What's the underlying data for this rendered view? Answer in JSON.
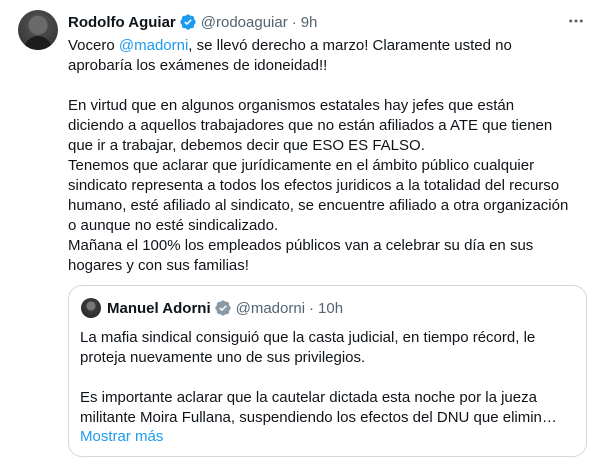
{
  "tweet": {
    "author_name": "Rodolfo Aguiar",
    "handle": "@rodoaguiar",
    "separator": "·",
    "time": "9h",
    "lines": [
      "Vocero ",
      "@madorni",
      ", se llevó derecho a marzo! Claramente usted no",
      "aprobaría los exámenes de idoneidad!!"
    ],
    "paragraph2": [
      "En virtud que en algunos organismos estatales hay jefes que están",
      "diciendo a aquellos trabajadores que no están afiliados a ATE que tienen",
      "que ir a trabajar, debemos decir que ESO ES FALSO.",
      "Tenemos que aclarar que jurídicamente en el ámbito público cualquier",
      "sindicato representa a todos los efectos juridicos a la totalidad del recurso",
      "humano, esté afiliado al sindicato, se encuentre afiliado a otra organización",
      "o aunque no esté sindicalizado.",
      "Mañana el 100% los empleados públicos van a celebrar su día en sus",
      "hogares y con sus familias!"
    ]
  },
  "quote": {
    "author_name": "Manuel Adorni",
    "handle": "@madorni",
    "separator": "·",
    "time": "10h",
    "lines": [
      "La mafia sindical consiguió que la casta judicial, en tiempo récord, le",
      "proteja nuevamente uno de sus privilegios.",
      "Es importante aclarar que la cautelar dictada esta noche por la jueza",
      "militante Moira Fullana, suspendiendo los efectos del DNU que elimin…"
    ],
    "show_more": "Mostrar más"
  },
  "colors": {
    "accent": "#1d9bf0",
    "muted": "#536471",
    "border": "#cfd9de"
  },
  "icons": [
    "verified-badge-icon",
    "more-options-icon"
  ]
}
